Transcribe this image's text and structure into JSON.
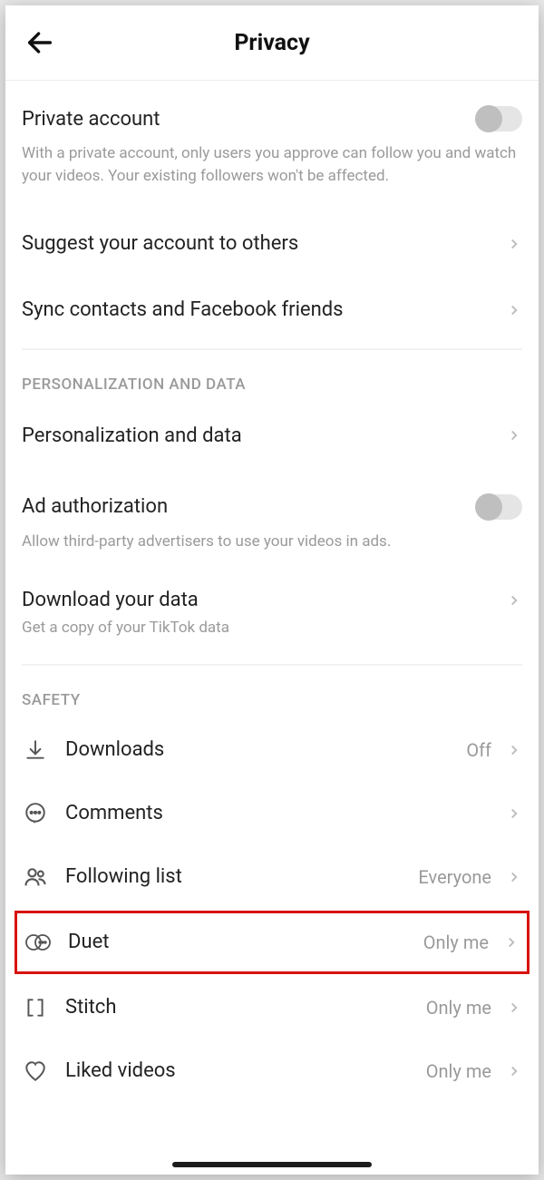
{
  "header": {
    "title": "Privacy"
  },
  "privateAccount": {
    "label": "Private account",
    "description": "With a private account, only users you approve can follow you and watch your videos. Your existing followers won't be affected."
  },
  "links": {
    "suggest": "Suggest your account to others",
    "sync": "Sync contacts and Facebook friends"
  },
  "personalization": {
    "header": "PERSONALIZATION AND DATA",
    "data": "Personalization and data",
    "adAuth": "Ad authorization",
    "adAuthDesc": "Allow third-party advertisers to use your videos in ads.",
    "download": "Download your data",
    "downloadDesc": "Get a copy of your TikTok data"
  },
  "safety": {
    "header": "SAFETY",
    "downloads": {
      "label": "Downloads",
      "value": "Off"
    },
    "comments": {
      "label": "Comments",
      "value": ""
    },
    "following": {
      "label": "Following list",
      "value": "Everyone"
    },
    "duet": {
      "label": "Duet",
      "value": "Only me"
    },
    "stitch": {
      "label": "Stitch",
      "value": "Only me"
    },
    "liked": {
      "label": "Liked videos",
      "value": "Only me"
    }
  }
}
